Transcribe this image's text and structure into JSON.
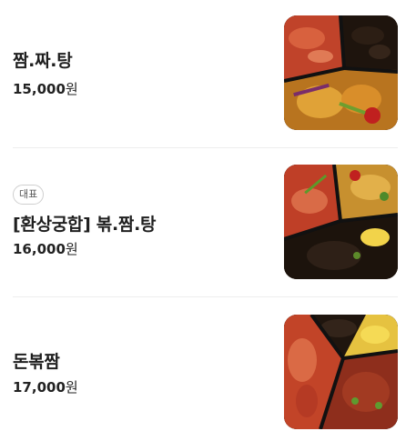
{
  "menu": {
    "items": [
      {
        "name": "짬.짜.탕",
        "price": "15,000",
        "currency": "원",
        "badge": "",
        "image": "food-photo"
      },
      {
        "name": "[환상궁합] 볶.짬.탕",
        "price": "16,000",
        "currency": "원",
        "badge": "대표",
        "image": "food-photo"
      },
      {
        "name": "돈볶짬",
        "price": "17,000",
        "currency": "원",
        "badge": "",
        "image": "food-photo"
      }
    ]
  },
  "colors": {
    "text": "#1f1f1f",
    "divider": "#eeeeee",
    "badge_border": "#cfcfcf"
  }
}
